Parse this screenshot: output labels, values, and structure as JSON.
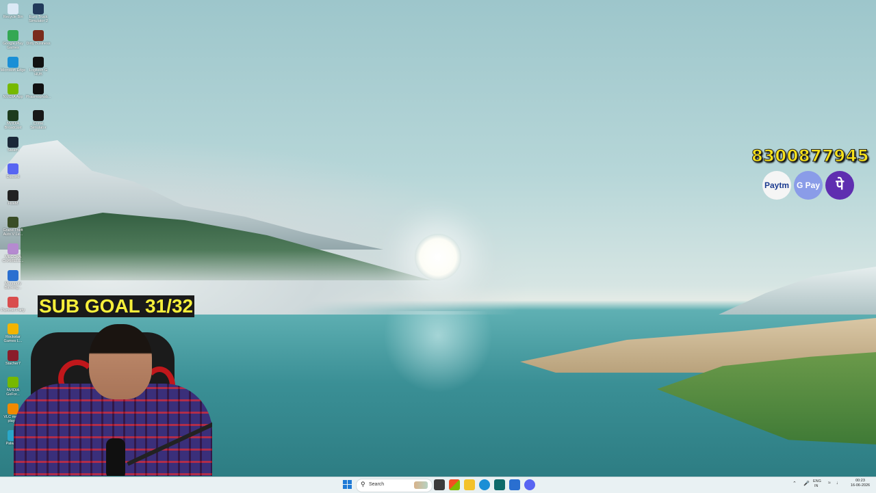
{
  "desktop_icons": [
    {
      "label": "Recycle Bin",
      "color": "#dbe9f5"
    },
    {
      "label": "Euro Truck Simulator 2",
      "color": "#223a5a"
    },
    {
      "label": "Google Play Games",
      "color": "#34a853"
    },
    {
      "label": "Dirty Business",
      "color": "#7a2b1c"
    },
    {
      "label": "Microsoft Edge",
      "color": "#1a8fd6"
    },
    {
      "label": "Logitech G HUB",
      "color": "#111111"
    },
    {
      "label": "NVIDIA App",
      "color": "#76b900"
    },
    {
      "label": "Phasmophob...",
      "color": "#111111"
    },
    {
      "label": "NVIDIA Broadcast",
      "color": "#1d3b1d"
    },
    {
      "label": "Crime Simulator",
      "color": "#181818"
    },
    {
      "label": "Steam",
      "color": "#1b2838"
    },
    {
      "label": "Discord",
      "color": "#5865f2"
    },
    {
      "label": "FiveM",
      "color": "#222222"
    },
    {
      "label": "Grand Theft Auto V Le...",
      "color": "#3a4d26"
    },
    {
      "label": "MECCHA CHAMELE...",
      "color": "#b58ad0"
    },
    {
      "label": "Monopoly Banking...",
      "color": "#2a6fd0"
    },
    {
      "label": "Pummel Party",
      "color": "#d94d4d"
    },
    {
      "label": "Rockstar Games L...",
      "color": "#f2b400"
    },
    {
      "label": "Stacher7",
      "color": "#8a1d2a"
    },
    {
      "label": "NVIDIA GeFor...",
      "color": "#76b900"
    },
    {
      "label": "VLC media player",
      "color": "#f08a00"
    },
    {
      "label": "Palworld",
      "color": "#2aa7c9"
    }
  ],
  "donation": {
    "phone": "8300877945",
    "payments": [
      {
        "label": "Paytm",
        "icon": "paytm-icon"
      },
      {
        "label": "G Pay",
        "icon": "gpay-icon"
      },
      {
        "label": "पे",
        "icon": "phonepe-icon"
      }
    ]
  },
  "sub_goal": "SUB GOAL 31/32",
  "taskbar": {
    "search_placeholder": "Search",
    "tray_lang_top": "ENG",
    "tray_lang_bottom": "IN",
    "clock_time": "00:23",
    "clock_date": "16-06-2026"
  },
  "colors": {
    "accent": "#1f7ad6",
    "subgoal_text": "#f7ef3a",
    "phone_text": "#f7e21b"
  }
}
